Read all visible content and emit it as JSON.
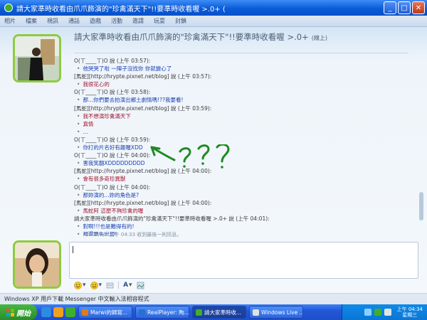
{
  "window": {
    "title": "請大家準時收看由爪爪飾演的\"珍禽滿天下\"!!要準時收看喔 >.0+ (",
    "buttons": {
      "minimize": "_",
      "maximize": "□",
      "close": "✕"
    }
  },
  "menu": [
    "相片",
    "檔案",
    "視訊",
    "通話",
    "遊戲",
    "活動",
    "邀請",
    "玩耍",
    "封鎖"
  ],
  "conversation": {
    "title": "請大家準時收看由爪爪飾演的\"珍禽滿天下\"!!要準時收看喔 >.0+",
    "status": "(線上)"
  },
  "chat_lines": [
    {
      "kind": "sender",
      "text": "O(ㄒ____ㄒ)O 說 (上午 03:57):"
    },
    {
      "kind": "msg",
      "text": "他哭哭了啦  一陣子沒找你  你就變心了",
      "color": "blue"
    },
    {
      "kind": "sender",
      "text": "[馬蛇][http://hrypte.pixnet.net/blog] 說 (上午 03:57):"
    },
    {
      "kind": "msg",
      "text": "我很花心的",
      "color": "red"
    },
    {
      "kind": "sender",
      "text": "O(ㄒ____ㄒ)O 說 (上午 03:58):"
    },
    {
      "kind": "msg",
      "text": "那...你們要去拍演出鄉土劇情嗎!??我要看!",
      "color": "blue"
    },
    {
      "kind": "sender",
      "text": "[馬蛇][http://hrypte.pixnet.net/blog] 說 (上午 03:59):"
    },
    {
      "kind": "msg",
      "text": "我不想演珍禽滿天下",
      "color": "red"
    },
    {
      "kind": "msg",
      "text": "真情",
      "color": "red"
    },
    {
      "kind": "msg",
      "text": "...",
      "color": "grey"
    },
    {
      "kind": "sender",
      "text": "O(ㄒ____ㄒ)O 說 (上午 03:59):"
    },
    {
      "kind": "msg",
      "text": "你打的片名好有趣喔XDD",
      "color": "blue"
    },
    {
      "kind": "sender",
      "text": "O(ㄒ____ㄒ)O 說 (上午 04:00):"
    },
    {
      "kind": "msg",
      "text": "害我笑翻XDDDDDDDDD",
      "color": "blue"
    },
    {
      "kind": "sender",
      "text": "[馬蛇][http://hrypte.pixnet.net/blog] 說 (上午 04:00):"
    },
    {
      "kind": "msg",
      "text": "會有很多奇珍異獸",
      "color": "red"
    },
    {
      "kind": "sender",
      "text": "O(ㄒ____ㄒ)O 說 (上午 04:00):"
    },
    {
      "kind": "msg",
      "text": "那妳演的...妳的角色是?",
      "color": "blue"
    },
    {
      "kind": "sender",
      "text": "[馬蛇][http://hrypte.pixnet.net/blog] 說 (上午 04:00):"
    },
    {
      "kind": "msg",
      "text": "馬蛇阿  這麼不夠珍禽的喔",
      "color": "red"
    },
    {
      "kind": "sender",
      "text": "請大家準時收看由爪爪飾演的\"珍禽滿天下\"!!要準時收看喔 >.0+ 說 (上午 04:01):"
    },
    {
      "kind": "msg",
      "text": "對啊!!!也是難得有的!",
      "color": "blue"
    },
    {
      "kind": "msg",
      "text": "那還要先出現!",
      "color": "blue"
    }
  ],
  "last_message_status": "2009/4/8 上午 04:33 收到最後一則訊息。",
  "annotation": {
    "arrow": "green-arrow",
    "marks": "???",
    "color": "#1f8a22"
  },
  "ad_line": "Windows XP 用戶下載 Messenger 中文輸入法相容程式",
  "taskbar": {
    "start_label": "開始",
    "tasks": [
      {
        "label": "Marwi的歸寫...",
        "active": false,
        "icon_color": "#e07b1a"
      },
      {
        "label": "RealPlayer: 陶...",
        "active": false,
        "icon_color": "#2a6fd1"
      },
      {
        "label": "請大家準時收...",
        "active": true,
        "icon_color": "#3fae2a"
      },
      {
        "label": "Windows Live ...",
        "active": false,
        "icon_color": "#e0e0e0"
      }
    ],
    "clock_time": "上午 04:34",
    "clock_day": "星期三"
  },
  "colors": {
    "accent_green": "#8ecb3f",
    "msg_blue": "#1a3fb0",
    "msg_red": "#a0152c"
  }
}
